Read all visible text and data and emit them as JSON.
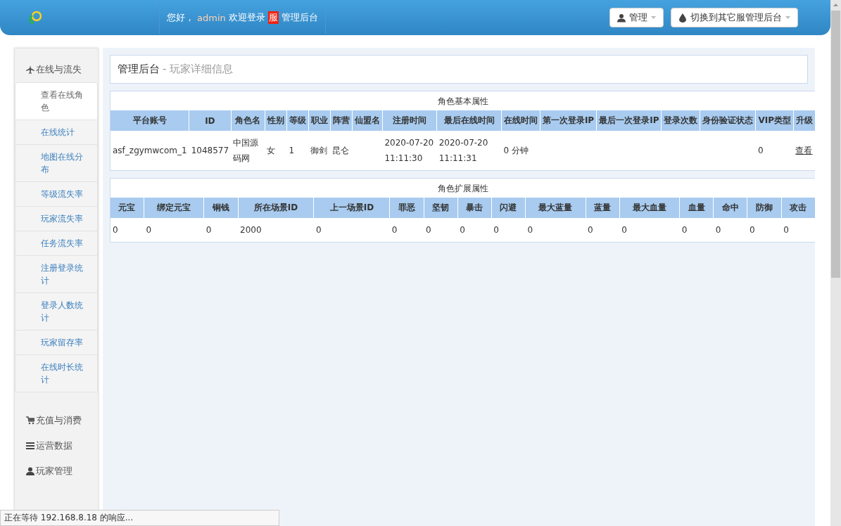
{
  "header": {
    "greeting": "您好，",
    "user": "admin",
    "welcome": "欢迎登录",
    "server_badge": "服",
    "suffix": "管理后台",
    "buttons": [
      {
        "kind": "user",
        "label": "管理"
      },
      {
        "kind": "drop",
        "label": "切换到其它服管理后台"
      }
    ]
  },
  "sidebar": {
    "groups": [
      {
        "kind": "plane",
        "label": "在线与流失",
        "items": [
          {
            "label": "查看在线角色",
            "selected": true
          },
          {
            "label": "在线统计",
            "selected": false
          },
          {
            "label": "地图在线分布",
            "selected": false
          },
          {
            "label": "等级流失率",
            "selected": false
          },
          {
            "label": "玩家流失率",
            "selected": false
          },
          {
            "label": "任务流失率",
            "selected": false
          },
          {
            "label": "注册登录统计",
            "selected": false
          },
          {
            "label": "登录人数统计",
            "selected": false
          },
          {
            "label": "玩家留存率",
            "selected": false
          },
          {
            "label": "在线时长统计",
            "selected": false
          }
        ]
      },
      {
        "kind": "cart",
        "label": "充值与消费"
      },
      {
        "kind": "list",
        "label": "运营数据"
      },
      {
        "kind": "user",
        "label": "玩家管理"
      }
    ]
  },
  "page_title": {
    "title": "管理后台",
    "subtitle": "- 玩家详细信息"
  },
  "tables": [
    {
      "caption": "角色基本属性",
      "columns": [
        "平台账号",
        "ID",
        "角色名",
        "性别",
        "等级",
        "职业",
        "阵营",
        "仙盟名",
        "注册时间",
        "最后在线时间",
        "在线时间",
        "第一次登录IP",
        "最后一次登录IP",
        "登录次数",
        "身份验证状态",
        "VIP类型",
        "升级"
      ],
      "rows": [
        [
          "asf_zgymwcom_1",
          "1048577",
          "中国源码网",
          "女",
          "1",
          "御剑",
          "昆仑",
          "",
          "2020-07-20 11:11:30",
          "2020-07-20 11:11:31",
          "0 分钟",
          "",
          "",
          "",
          "",
          "0",
          {
            "link": "查看"
          }
        ]
      ]
    },
    {
      "caption": "角色扩展属性",
      "columns": [
        "元宝",
        "绑定元宝",
        "铜钱",
        "所在场景ID",
        "上一场景ID",
        "罪恶",
        "坚韧",
        "暴击",
        "闪避",
        "最大蓝量",
        "蓝量",
        "最大血量",
        "血量",
        "命中",
        "防御",
        "攻击"
      ],
      "rows": [
        [
          "0",
          "0",
          "0",
          "2000",
          "0",
          "0",
          "0",
          "0",
          "0",
          "0",
          "0",
          "0",
          "0",
          "0",
          "0",
          "0"
        ]
      ]
    }
  ],
  "status_bar": "正在等待 192.168.8.18 的响应..."
}
